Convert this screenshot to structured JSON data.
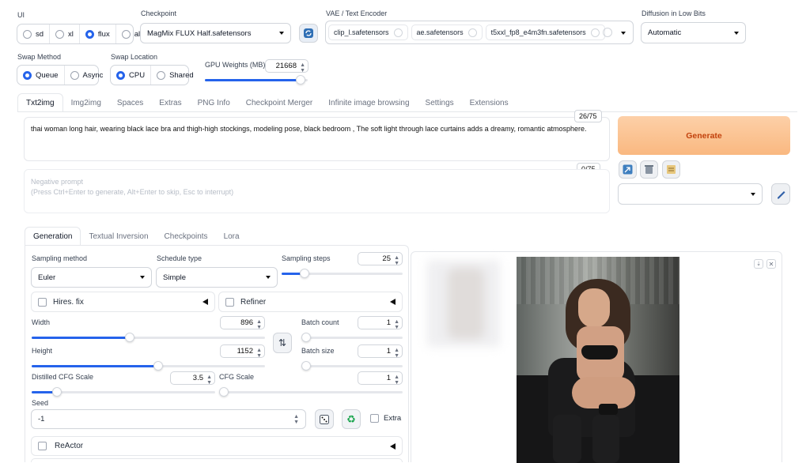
{
  "ui": {
    "label": "UI",
    "options": [
      "sd",
      "xl",
      "flux",
      "all"
    ],
    "selected": "flux"
  },
  "checkpoint": {
    "label": "Checkpoint",
    "value": "MagMix FLUX Half.safetensors"
  },
  "vae": {
    "label": "VAE / Text Encoder",
    "tags": [
      "clip_l.safetensors",
      "ae.safetensors",
      "t5xxl_fp8_e4m3fn.safetensors"
    ]
  },
  "diffusion_low_bits": {
    "label": "Diffusion in Low Bits",
    "value": "Automatic"
  },
  "swap_method": {
    "label": "Swap Method",
    "options": [
      "Queue",
      "Async"
    ],
    "selected": "Queue"
  },
  "swap_location": {
    "label": "Swap Location",
    "options": [
      "CPU",
      "Shared"
    ],
    "selected": "CPU"
  },
  "gpu_weights": {
    "label": "GPU Weights (MB)",
    "value": "21668",
    "level": 0.93
  },
  "main_tabs": [
    "Txt2img",
    "Img2img",
    "Spaces",
    "Extras",
    "PNG Info",
    "Checkpoint Merger",
    "Infinite image browsing",
    "Settings",
    "Extensions"
  ],
  "prompt": {
    "text": "thai woman long hair, wearing black lace bra and thigh-high stockings, modeling pose, black bedroom , The soft light through lace curtains adds a dreamy, romantic atmosphere.",
    "counter": "26/75"
  },
  "negative_prompt": {
    "placeholder_line1": "Negative prompt",
    "placeholder_line2": "(Press Ctrl+Enter to generate, Alt+Enter to skip, Esc to interrupt)",
    "counter": "0/75"
  },
  "generate_label": "Generate",
  "sub_tabs": [
    "Generation",
    "Textual Inversion",
    "Checkpoints",
    "Lora"
  ],
  "sampling_method": {
    "label": "Sampling method",
    "value": "Euler"
  },
  "schedule_type": {
    "label": "Schedule type",
    "value": "Simple"
  },
  "sampling_steps": {
    "label": "Sampling steps",
    "value": "25"
  },
  "hires_fix": {
    "label": "Hires. fix"
  },
  "refiner": {
    "label": "Refiner"
  },
  "width": {
    "label": "Width",
    "value": "896"
  },
  "height": {
    "label": "Height",
    "value": "1152"
  },
  "batch_count": {
    "label": "Batch count",
    "value": "1"
  },
  "batch_size": {
    "label": "Batch size",
    "value": "1"
  },
  "distilled_cfg": {
    "label": "Distilled CFG Scale",
    "value": "3.5"
  },
  "cfg_scale": {
    "label": "CFG Scale",
    "value": "1"
  },
  "seed": {
    "label": "Seed",
    "value": "-1"
  },
  "extra_label": "Extra",
  "reactor_label": "ReActor",
  "colors": {
    "accent": "#2563eb",
    "generate_bg": "#fbbf82",
    "generate_text": "#c2410c"
  }
}
